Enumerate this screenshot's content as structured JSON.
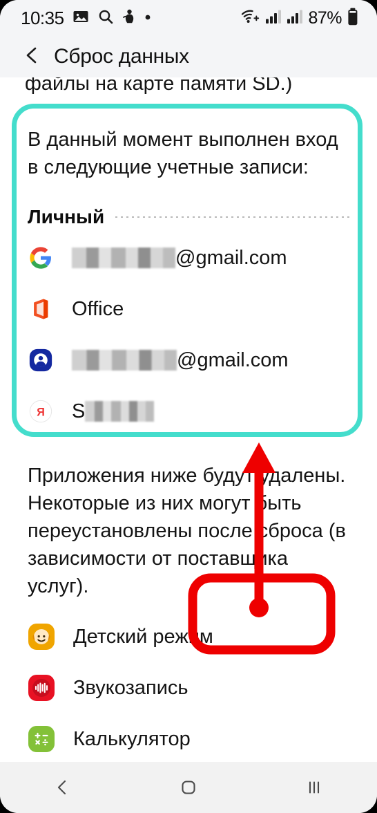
{
  "status_bar": {
    "time": "10:35",
    "battery_percent": "87%",
    "left_icons": [
      "image-icon",
      "search-icon",
      "person-figure-icon",
      "dot-icon"
    ],
    "right_icons": [
      "wifi-plus-icon",
      "signal-bars-icon",
      "signal-bars-2-icon",
      "battery-icon"
    ]
  },
  "action_bar": {
    "back_icon": "chevron-left-icon",
    "title": "Сброс данных"
  },
  "sheet": {
    "clipped_top_line": "файлы на карте памяти SD.)",
    "accounts_intro": "В данный момент выполнен вход в следующие учетные записи:",
    "section_label": "Личный",
    "accounts": [
      {
        "icon": "google-icon",
        "redacted": true,
        "redact_width": 150,
        "suffix": "@gmail.com"
      },
      {
        "icon": "office-icon",
        "redacted": false,
        "redact_width": 0,
        "suffix": "Office"
      },
      {
        "icon": "samsung-account-icon",
        "redacted": true,
        "redact_width": 152,
        "suffix": "@gmail.com"
      },
      {
        "icon": "yandex-icon",
        "redacted": true,
        "redact_width": 100,
        "prefix": "S",
        "suffix": ""
      }
    ],
    "apps_paragraph": "Приложения ниже будут удалены. Некоторые из них могут быть переустановлены после сброса (в зависимости от поставщика услуг).",
    "apps": [
      {
        "icon": "kids-mode-icon",
        "label": "Детский режим"
      },
      {
        "icon": "voice-recorder-icon",
        "label": "Звукозапись"
      },
      {
        "icon": "calculator-icon",
        "label": "Калькулятор"
      }
    ]
  },
  "annotations": {
    "teal_highlight": {
      "color": "#44ddcc",
      "shape": "rounded-rect"
    },
    "red_callout": {
      "color": "#ee0000",
      "shape": "rounded-rect-with-arrow"
    }
  },
  "nav_bar": {
    "back": "nav-back-icon",
    "home": "nav-home-icon",
    "recents": "nav-recents-icon"
  }
}
